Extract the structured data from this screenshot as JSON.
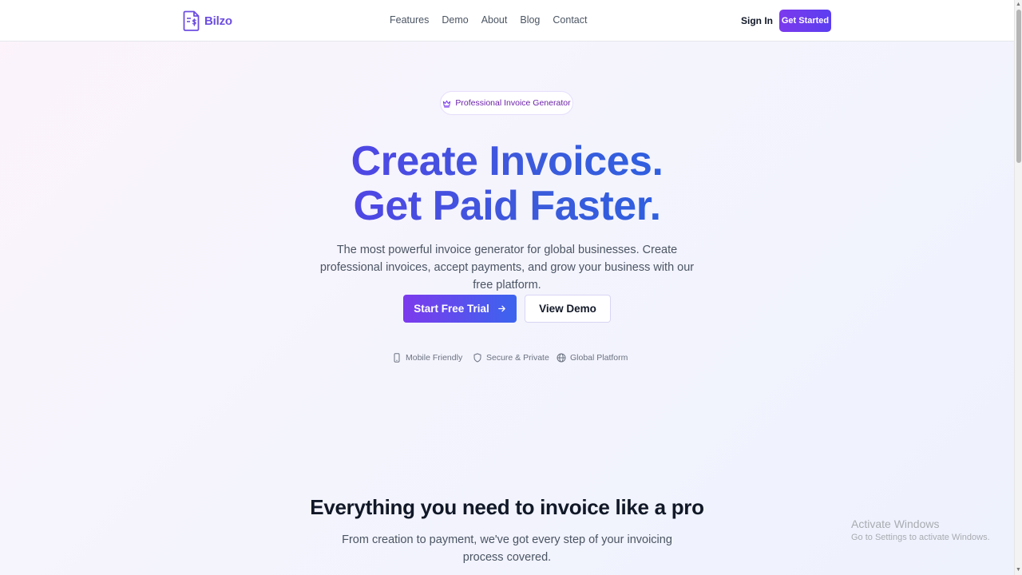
{
  "header": {
    "logo_text": "Bilzo",
    "nav": [
      "Features",
      "Demo",
      "About",
      "Blog",
      "Contact"
    ],
    "sign_in": "Sign In",
    "get_started": "Get Started"
  },
  "hero": {
    "badge": "Professional Invoice Generator",
    "badge_icon": "crown-icon",
    "headline_line1": "Create Invoices.",
    "headline_line2": "Get Paid Faster.",
    "subtitle": "The most powerful invoice generator for global businesses. Create professional invoices, accept payments, and grow your business with our free platform.",
    "primary_cta": "Start Free Trial",
    "secondary_cta": "View Demo",
    "features": [
      {
        "label": "Mobile Friendly",
        "icon": "smartphone-icon"
      },
      {
        "label": "Secure & Private",
        "icon": "shield-icon"
      },
      {
        "label": "Global Platform",
        "icon": "globe-icon"
      }
    ]
  },
  "features_section": {
    "title": "Everything you need to invoice like a pro",
    "subtitle": "From creation to payment, we've got every step of your invoicing process covered."
  },
  "watermark": {
    "title": "Activate Windows",
    "subtitle": "Go to Settings to activate Windows."
  },
  "colors": {
    "brand": "#6d4ee0",
    "headline": "#4f46e5",
    "cta_gradient_start": "#7c3aed",
    "cta_gradient_end": "#3b64ee"
  }
}
